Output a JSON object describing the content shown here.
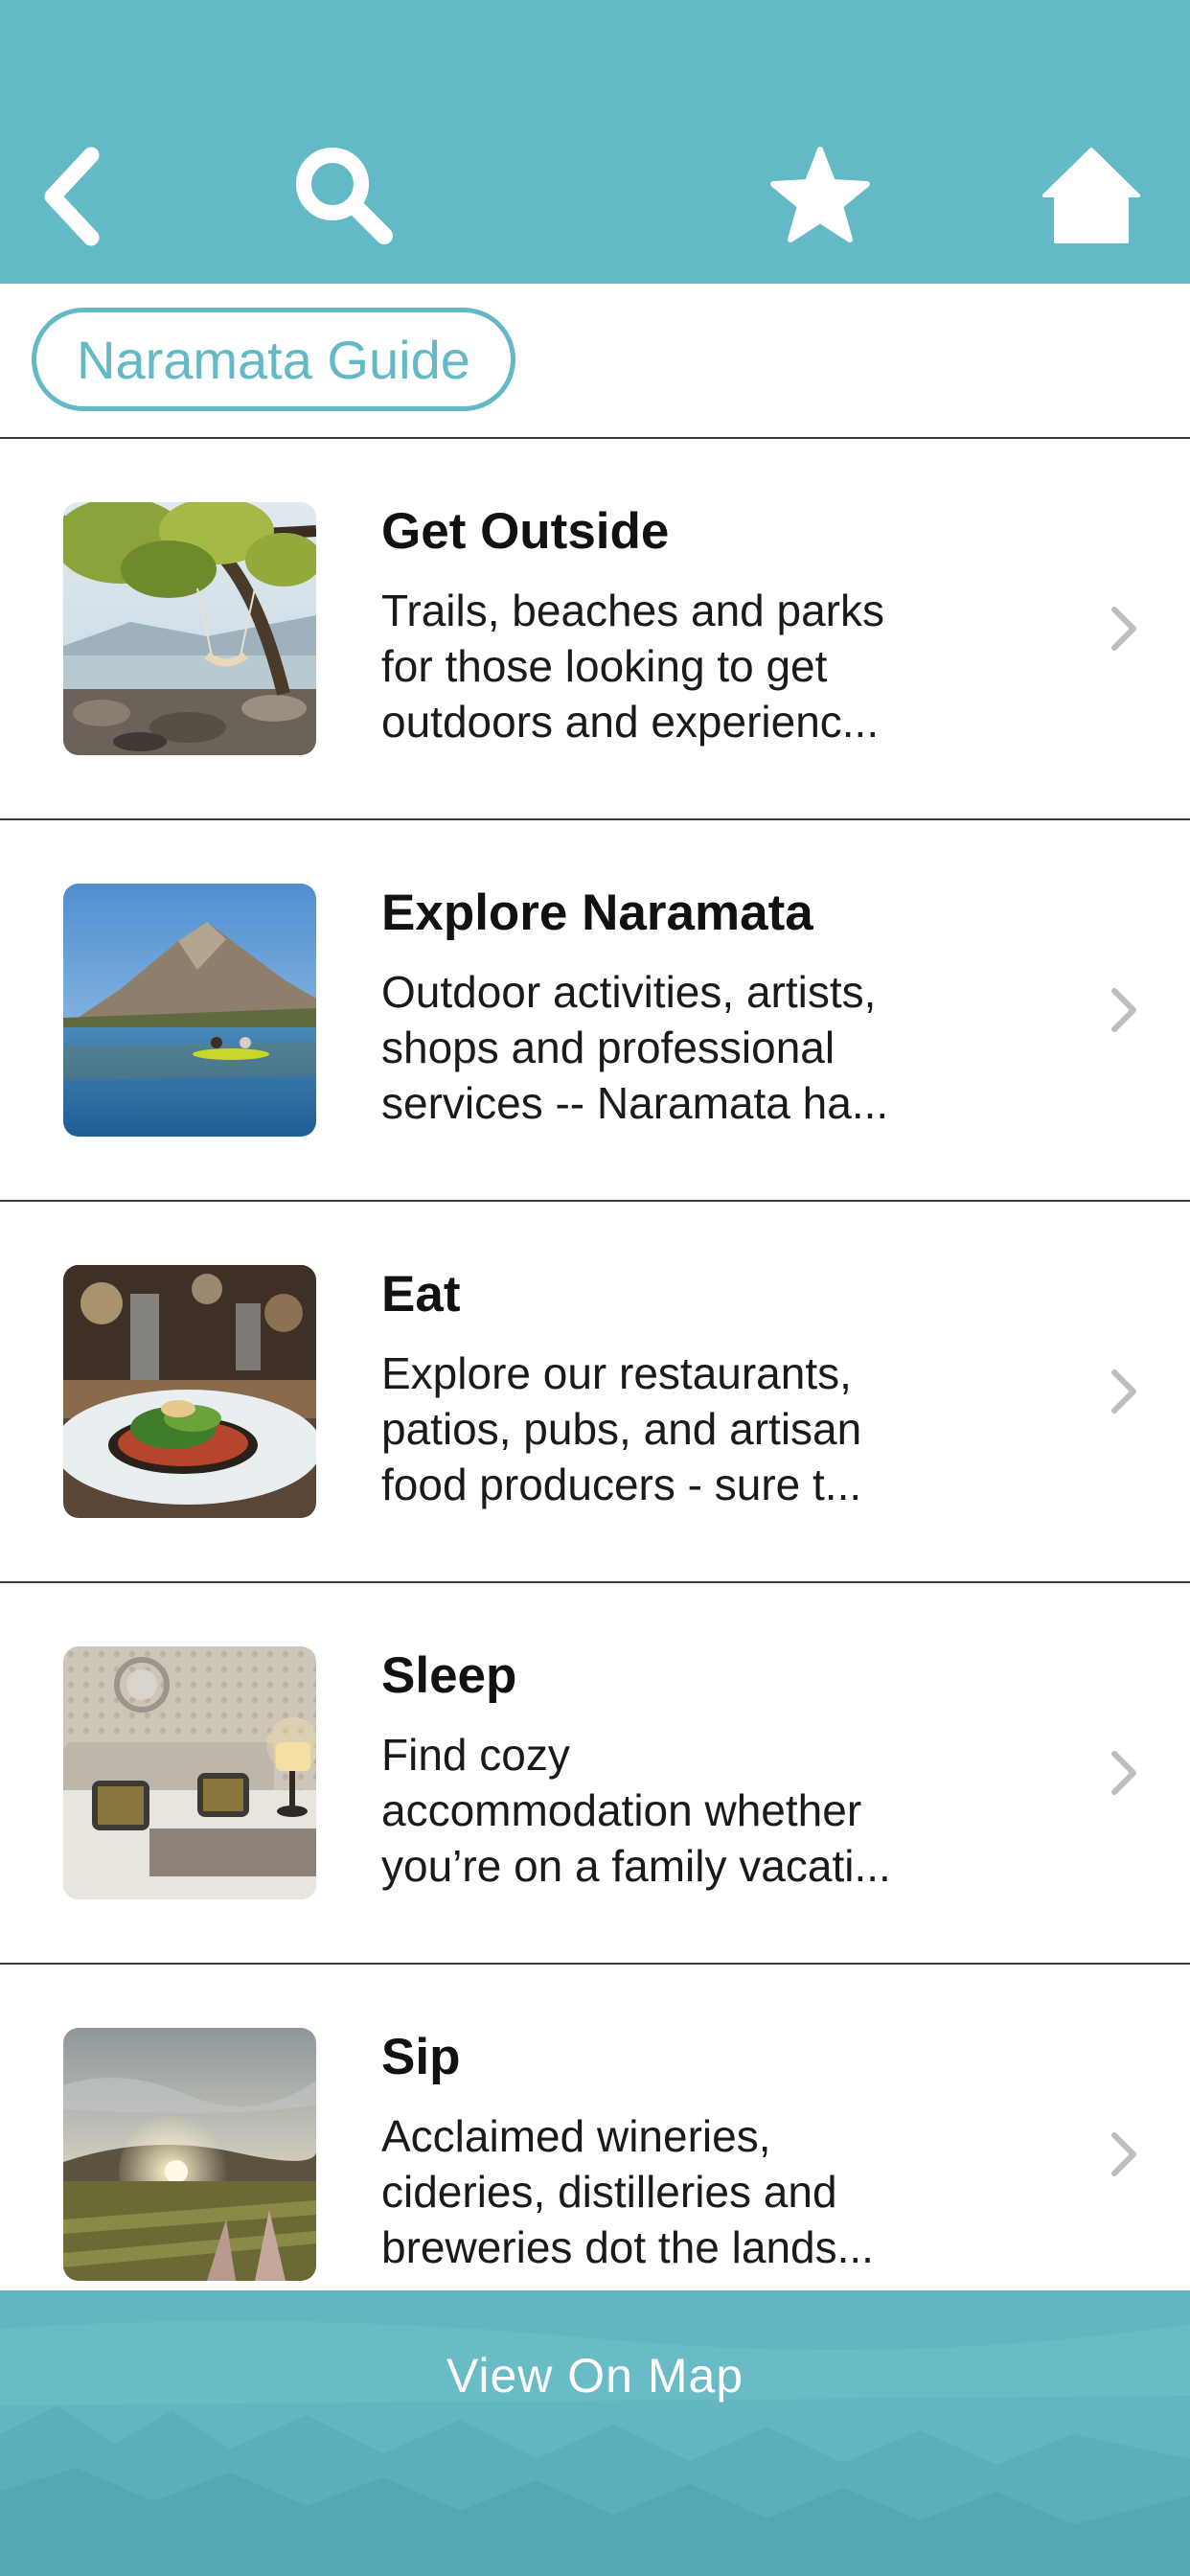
{
  "header": {
    "back_icon": "chevron-left-icon",
    "search_icon": "search-icon",
    "favorite_icon": "star-icon",
    "home_icon": "home-icon",
    "background_color": "#63b9c6"
  },
  "guide": {
    "chip_label": "Naramata Guide",
    "accent_color": "#63b9c6"
  },
  "items": [
    {
      "title": "Get Outside",
      "description_lines": [
        "Trails, beaches and parks",
        "for those looking to get",
        "outdoors and experienc..."
      ],
      "image": "lakeside-hammock-photo"
    },
    {
      "title": "Explore Naramata",
      "description_lines": [
        "Outdoor activities, artists,",
        "shops and professional",
        "services -- Naramata ha..."
      ],
      "image": "kayakers-mountain-lake-photo"
    },
    {
      "title": "Eat",
      "description_lines": [
        "Explore our restaurants,",
        "patios,  pubs, and artisan",
        "food producers  - sure t..."
      ],
      "image": "plated-dish-photo"
    },
    {
      "title": "Sleep",
      "description_lines": [
        "Find cozy",
        "accommodation whether",
        "you’re on a family vacati..."
      ],
      "image": "hotel-bedroom-photo"
    },
    {
      "title": "Sip",
      "description_lines": [
        "Acclaimed wineries,",
        "cideries, distilleries and",
        "breweries dot the lands..."
      ],
      "image": "vineyard-sunset-photo"
    }
  ],
  "footer": {
    "map_button_label": "View On Map"
  }
}
